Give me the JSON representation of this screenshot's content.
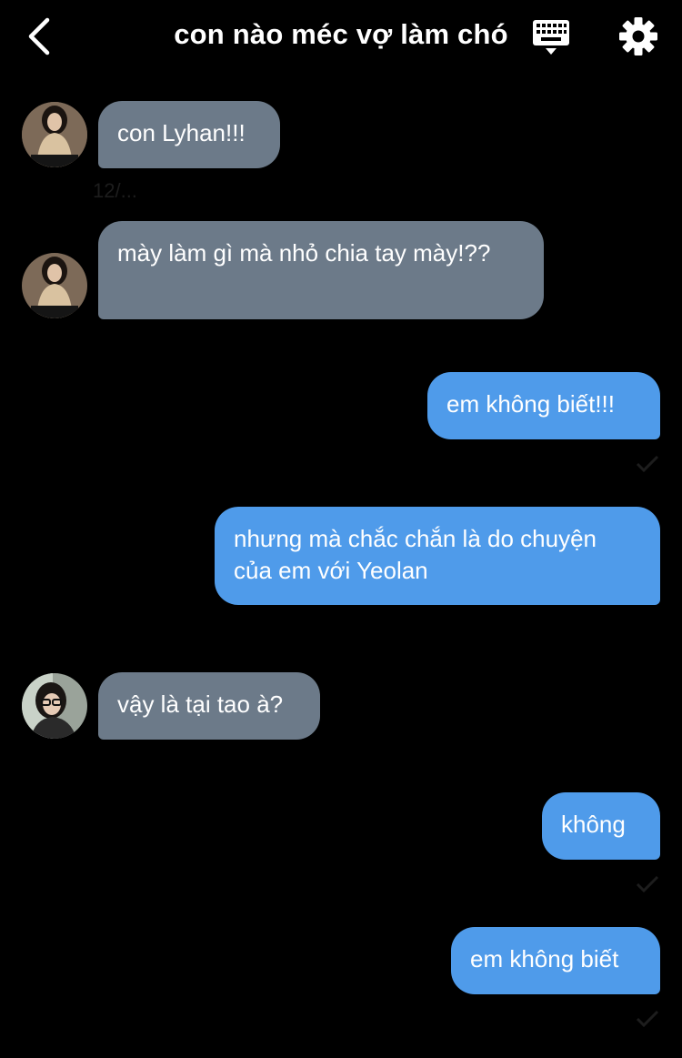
{
  "header": {
    "title": "con nào méc vợ làm chó",
    "back_icon": "chevron-left-icon",
    "keyboard_icon": "keyboard-icon",
    "settings_icon": "gear-icon"
  },
  "messages": [
    {
      "direction": "in",
      "text": "con Lyhan!!!",
      "timestamp": "12/..."
    },
    {
      "direction": "in",
      "text": "mày làm gì mà nhỏ chia tay mày!??"
    },
    {
      "direction": "out",
      "text": "em không biết!!!"
    },
    {
      "direction": "out",
      "text": "nhưng mà chắc chắn là do chuyện của em với Yeolan"
    },
    {
      "direction": "in",
      "text": "vậy là tại tao à?"
    },
    {
      "direction": "out",
      "text": "không"
    },
    {
      "direction": "out",
      "text": "em không biết"
    }
  ],
  "colors": {
    "incoming_bubble": "#6c7a89",
    "outgoing_bubble": "#4f9bea",
    "background": "#000000"
  }
}
